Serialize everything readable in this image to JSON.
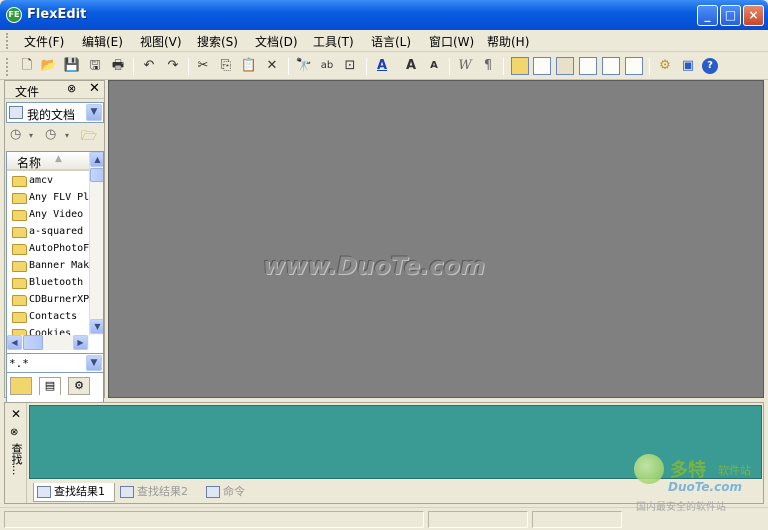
{
  "window": {
    "title": "FlexEdit",
    "app_icon_text": "FE",
    "minimize": "_",
    "maximize": "□",
    "close": "×"
  },
  "menu": [
    "文件(F)",
    "编辑(E)",
    "视图(V)",
    "搜索(S)",
    "文档(D)",
    "工具(T)",
    "语言(L)",
    "窗口(W)",
    "帮助(H)"
  ],
  "toolbar": {
    "new": "🗋",
    "open": "📂",
    "save": "💾",
    "save_all": "🖫",
    "print": "🖶",
    "undo": "↶",
    "redo": "↷",
    "cut": "✂",
    "copy": "⎘",
    "paste": "📋",
    "delete": "✕",
    "find": "🔭",
    "replace": "ab",
    "goto": "⊡",
    "font_color": "A",
    "font_bigger": "A",
    "font_smaller": "A",
    "wordwrap": "W",
    "para": "¶"
  },
  "file_panel": {
    "title": "文件",
    "pin": "⊗",
    "close": "✕",
    "location": "我的文档",
    "column_name": "名称",
    "sort_arrow": "▲",
    "items": [
      "amcv",
      "Any FLV Pl",
      "Any Video",
      "a-squared",
      "AutoPhotoF",
      "Banner Mak",
      "Bluetooth",
      "CDBurnerXP",
      "Contacts",
      "Cookies"
    ],
    "filter": "*.*"
  },
  "editor": {
    "watermark": "www.DuoTe.com"
  },
  "dock": {
    "side_label": "查找...",
    "close": "✕",
    "pin": "⊗",
    "tabs": [
      "查找结果1",
      "查找结果2",
      "命令"
    ]
  },
  "logo": {
    "name": "多特",
    "sub": "软件站",
    "site": "DuoTe.com",
    "slogan": "国内最安全的软件站"
  }
}
